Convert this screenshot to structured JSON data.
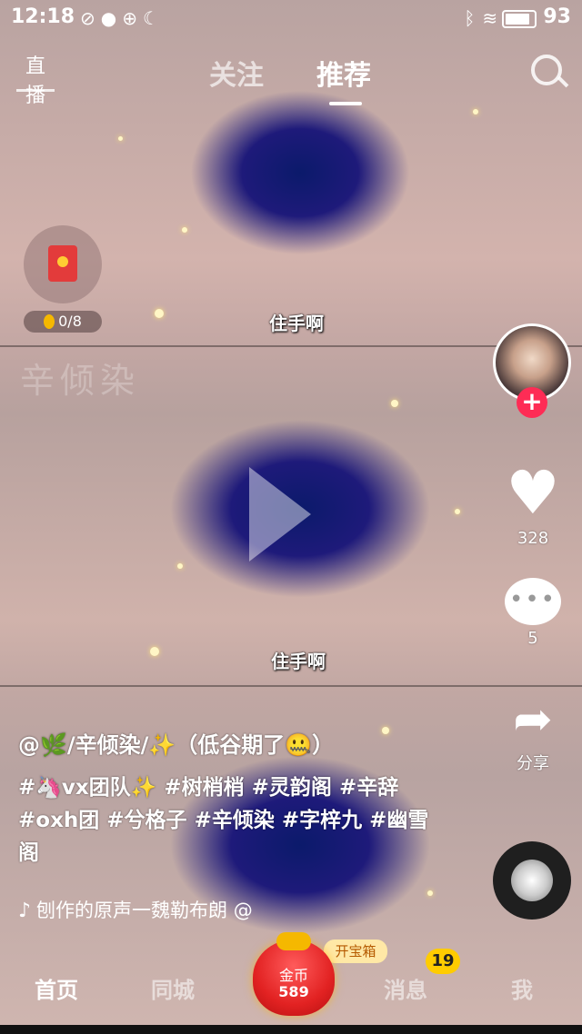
{
  "status_bar": {
    "time": "12:18",
    "left_icons": [
      "do-not-disturb-icon",
      "chat-icon",
      "download-icon",
      "moon-icon"
    ],
    "right_icons": [
      "bluetooth-icon",
      "wifi-icon",
      "screen-icon"
    ],
    "battery": "93"
  },
  "top_nav": {
    "live_label": "直播",
    "tabs": [
      {
        "label": "关注",
        "active": false
      },
      {
        "label": "推荐",
        "active": true
      }
    ],
    "search_icon": "search-icon"
  },
  "red_packet": {
    "progress_text": "0/8",
    "progress": 0
  },
  "video": {
    "subtitles": [
      "住手啊",
      "住手啊"
    ],
    "watermark": "辛倾染"
  },
  "side_actions": {
    "likes": "328",
    "comments": "5",
    "share_label": "分享",
    "follow_plus": "+"
  },
  "caption": {
    "author": "@🌿/辛倾染/✨（低谷期了🤐）",
    "tags": "#🦄vx团队✨ #树梢梢 #灵韵阁 #辛辞 #oxh团 #兮格子 #辛倾染 #字梓九 #幽雪阁",
    "music": "刨作的原声一魏勒布朗 @"
  },
  "treasure": {
    "label": "开宝箱",
    "coin_label": "金币",
    "coin_count": "589"
  },
  "bottom_nav": {
    "home": "首页",
    "city": "同城",
    "messages": "消息",
    "me": "我",
    "message_badge": "19"
  },
  "colors": {
    "accent_red": "#fe2c55",
    "badge_yellow": "#ffcc00"
  }
}
